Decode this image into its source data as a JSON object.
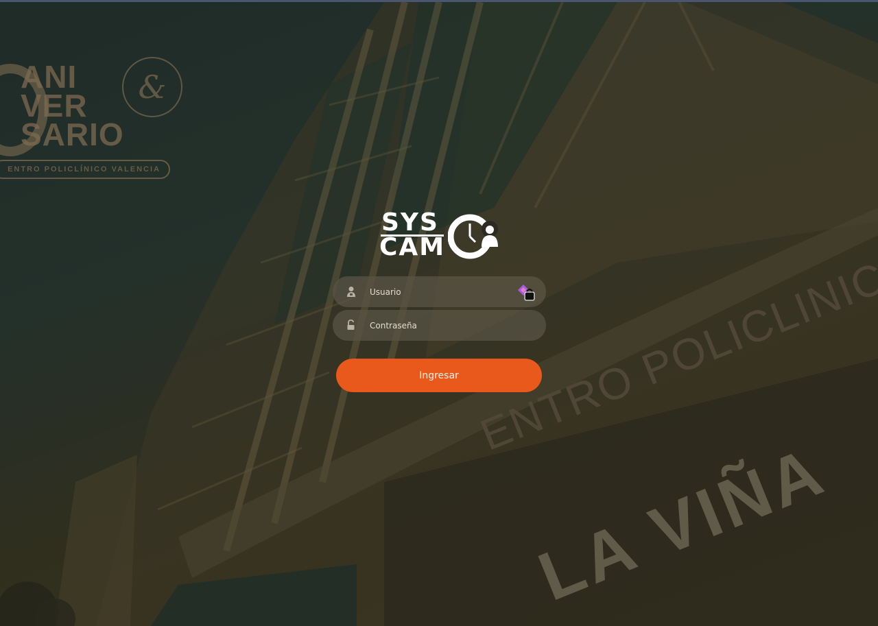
{
  "brand": {
    "line1": "SYS",
    "line2": "CAM"
  },
  "anniversary_logo": {
    "line1": "ANI",
    "line2": "VER",
    "line3": "SARIO",
    "ampersand": "&",
    "tagline": "ENTRO POLICLÍNICO VALENCIA"
  },
  "building_sign": {
    "upper": "ENTRO POLICLINIC",
    "lower": "LA VIÑA"
  },
  "login": {
    "username_placeholder": "Usuario",
    "password_placeholder": "Contraseña",
    "submit_label": "Ingresar"
  },
  "colors": {
    "accent": "#e8591b",
    "field_bg": "#5a5446"
  },
  "icons": {
    "username": "user-icon",
    "password": "unlock-icon",
    "password_manager": "password-manager-icon",
    "brand": "clock-user-icon"
  }
}
